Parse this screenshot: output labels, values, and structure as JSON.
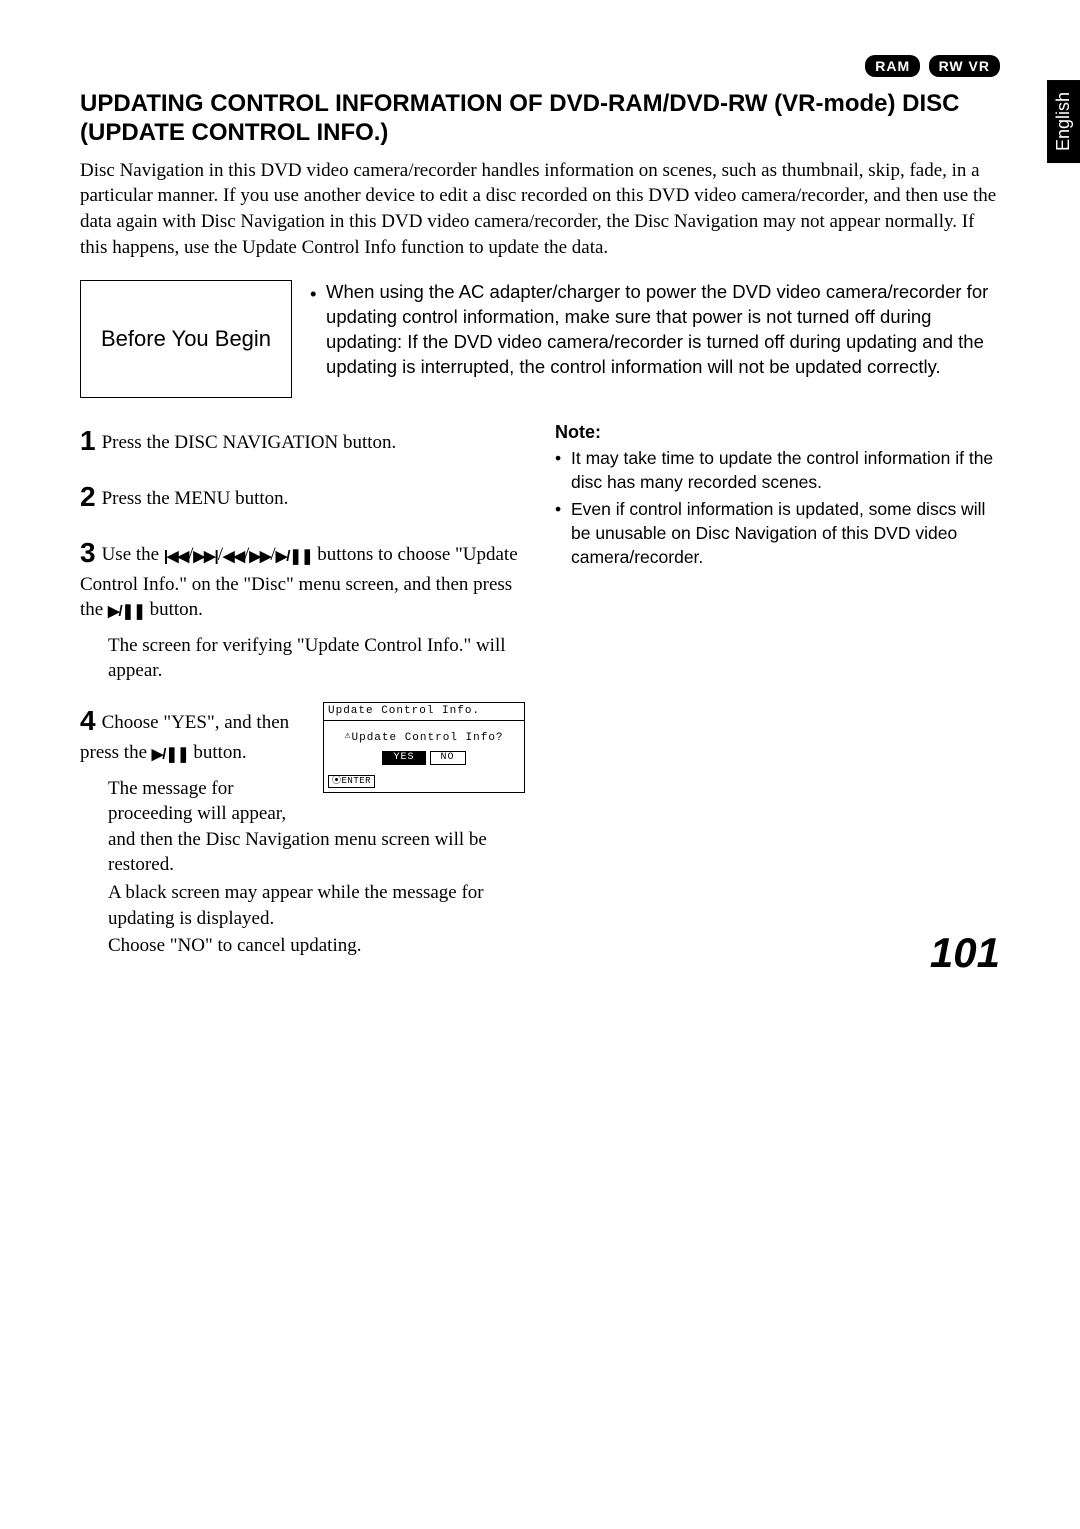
{
  "badges": {
    "ram": "RAM",
    "rwvr": "RW VR"
  },
  "lang_tab": "English",
  "title": "UPDATING CONTROL INFORMATION OF DVD-RAM/DVD-RW (VR-mode) DISC (UPDATE CONTROL INFO.)",
  "intro": "Disc Navigation in this DVD video camera/recorder handles information on scenes, such as thumbnail, skip, fade, in a particular manner. If you use another device to edit a disc recorded on this DVD video camera/recorder, and then use the data again with Disc Navigation in this DVD video camera/recorder, the Disc Navigation may not appear normally. If this happens, use the Update Control Info function to update the data.",
  "before": {
    "label": "Before You Begin",
    "item": "When using the AC adapter/charger to power the DVD video camera/recorder for updating control information, make sure that power is not turned off during updating: If the DVD video camera/recorder is turned off during updating and the updating is interrupted, the control information will not be updated correctly."
  },
  "steps": {
    "s1": "Press the DISC NAVIGATION button.",
    "s2": "Press the MENU button.",
    "s3a": "Use the ",
    "s3b": " buttons to choose \"Update Control Info.\" on the \"Disc\" menu screen, and then press the ",
    "s3c": " button.",
    "s3d": "The screen for verifying \"Update Control Info.\" will appear.",
    "s4a": "Choose \"YES\", and then press the ",
    "s4b": " button.",
    "s4c": "The message for proceeding will appear, and then the Disc Navigation menu screen will be restored.",
    "s4d": "A black screen may appear while the message for updating is displayed.",
    "s4e": "Choose \"NO\" to cancel updating."
  },
  "note": {
    "head": "Note:",
    "n1": "It may take time to update the control information if the disc has many recorded scenes.",
    "n2": "Even if control information is updated, some discs will be unusable on Disc Navigation of this DVD video camera/recorder."
  },
  "lcd": {
    "title": "Update Control Info.",
    "question": "Update Control Info?",
    "yes": "YES",
    "no": "NO",
    "enter": "ENTER"
  },
  "page_number": "101"
}
